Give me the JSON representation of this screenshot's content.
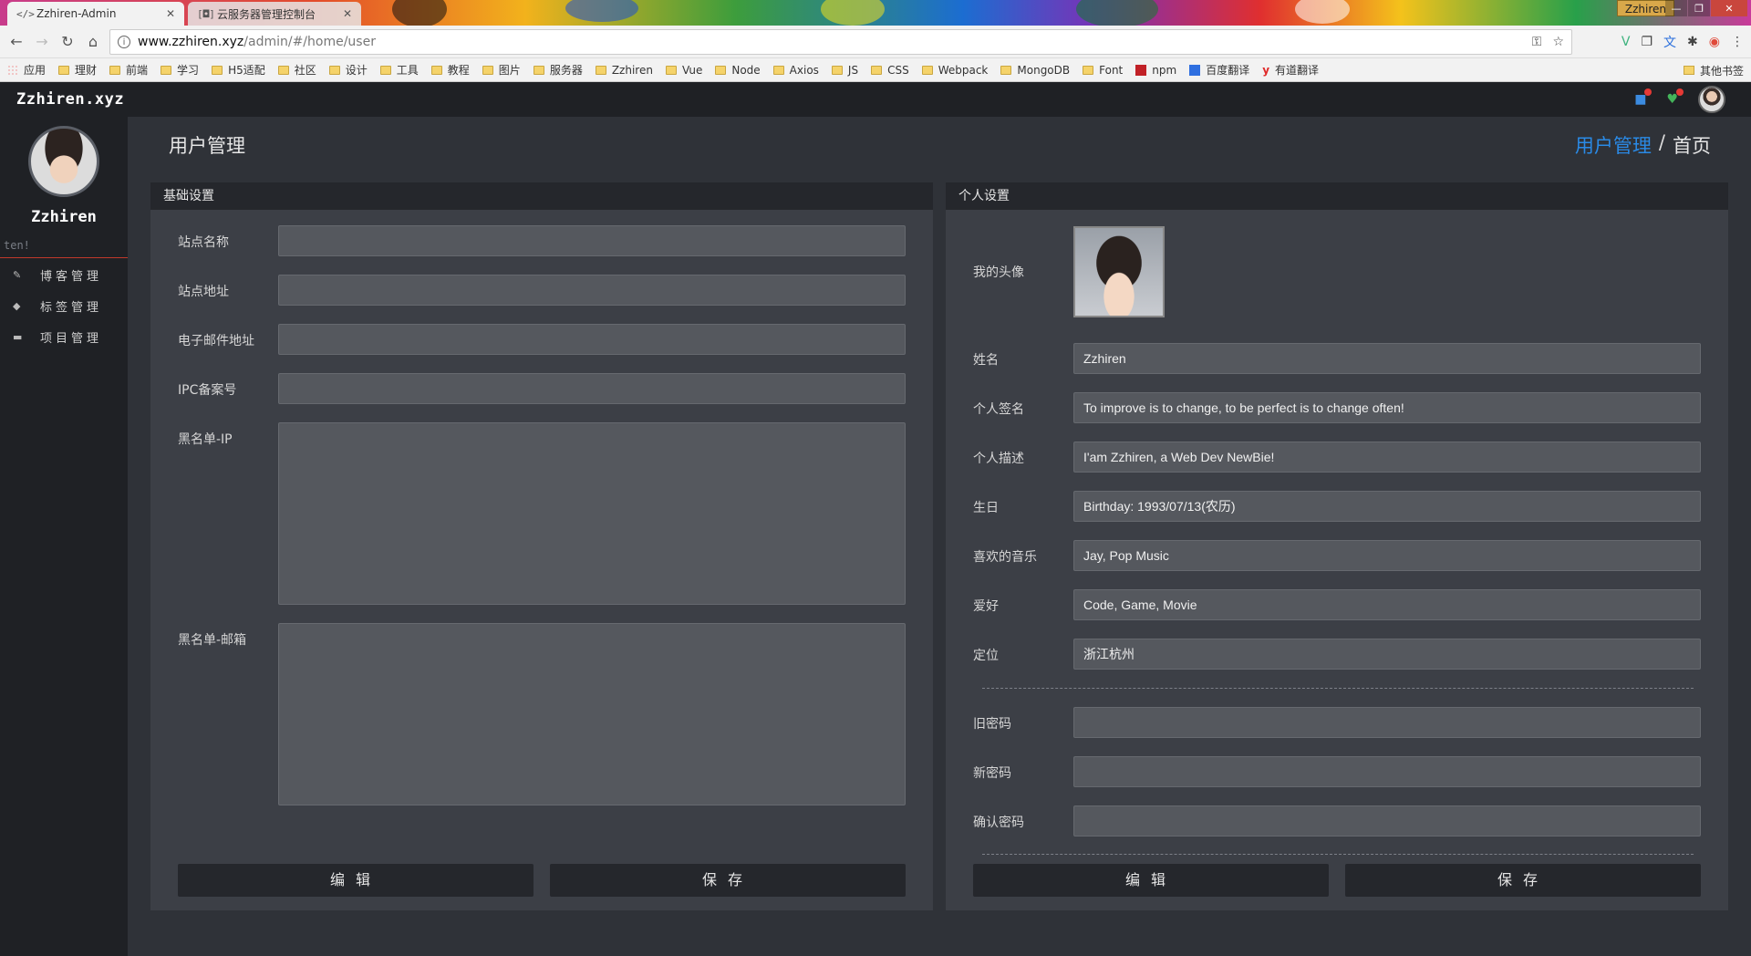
{
  "browser": {
    "tabs": [
      {
        "title": "Zzhiren-Admin",
        "icon": "code-icon"
      },
      {
        "title": "云服务器管理控制台",
        "icon": "cloud-console-icon"
      }
    ],
    "window_user": "Zzhiren",
    "url": {
      "host": "www.zzhiren.xyz",
      "path": "/admin/#/home/user"
    },
    "bookmarks": [
      "应用",
      "理财",
      "前端",
      "学习",
      "H5适配",
      "社区",
      "设计",
      "工具",
      "教程",
      "图片",
      "服务器",
      "Zzhiren",
      "Vue",
      "Node",
      "Axios",
      "JS",
      "CSS",
      "Webpack",
      "MongoDB",
      "Font",
      "npm",
      "百度翻译",
      "有道翻译"
    ],
    "other_bookmarks": "其他书签"
  },
  "app": {
    "brand": "Zzhiren.xyz",
    "profile": {
      "name": "Zzhiren",
      "sign": "ten!"
    },
    "menu": [
      {
        "label": "博客管理",
        "icon": "edit-icon"
      },
      {
        "label": "标签管理",
        "icon": "tag-icon"
      },
      {
        "label": "项目管理",
        "icon": "folder-icon"
      }
    ],
    "page_title": "用户管理",
    "breadcrumb": {
      "link": "用户管理",
      "sep": "/",
      "current": "首页"
    },
    "accent_color": "#2a8ae6"
  },
  "basic": {
    "header": "基础设置",
    "site_name_label": "站点名称",
    "site_url_label": "站点地址",
    "email_label": "电子邮件地址",
    "icp_label": "IPC备案号",
    "blacklist_ip_label": "黑名单-IP",
    "blacklist_email_label": "黑名单-邮箱",
    "edit_label": "编辑",
    "save_label": "保存"
  },
  "personal": {
    "header": "个人设置",
    "avatar_label": "我的头像",
    "name_label": "姓名",
    "name_value": "Zzhiren",
    "sign_label": "个人签名",
    "sign_value": "To improve is to change, to be perfect is to change often!",
    "desc_label": "个人描述",
    "desc_value": "I'am Zzhiren, a Web Dev NewBie!",
    "birthday_label": "生日",
    "birthday_value": "Birthday: 1993/07/13(农历)",
    "music_label": "喜欢的音乐",
    "music_value": "Jay, Pop Music",
    "hobby_label": "爱好",
    "hobby_value": "Code, Game, Movie",
    "location_label": "定位",
    "location_value": "浙江杭州",
    "old_pwd_label": "旧密码",
    "new_pwd_label": "新密码",
    "confirm_pwd_label": "确认密码",
    "edit_label": "编辑",
    "save_label": "保存"
  }
}
